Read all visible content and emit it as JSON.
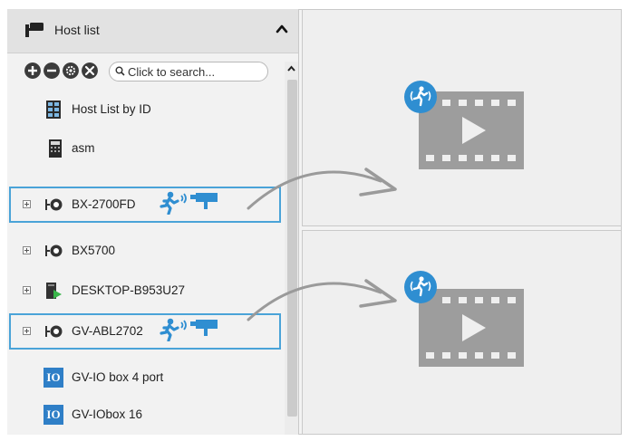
{
  "host_panel": {
    "title": "Host list",
    "header_icon": "camera-mount-icon",
    "collapse_icon": "chevron-up-icon"
  },
  "toolbar": {
    "buttons": [
      "add-icon",
      "remove-icon",
      "settings-icon",
      "tools-icon"
    ],
    "search_placeholder": "Click to search..."
  },
  "tree": {
    "items": [
      {
        "label": "Host List by ID",
        "icon": "host-list-icon"
      },
      {
        "label": "asm",
        "icon": "calculator-icon"
      },
      {
        "label": "BX-2700FD",
        "icon": "camera-icon",
        "expandable": true,
        "highlighted": true
      },
      {
        "label": "BX5700",
        "icon": "camera-icon",
        "expandable": true
      },
      {
        "label": "DESKTOP-B953U27",
        "icon": "computer-icon",
        "expandable": true
      },
      {
        "label": "GV-ABL2702",
        "icon": "camera-icon",
        "expandable": true,
        "highlighted": true
      },
      {
        "label": "GV-IO box 4 port",
        "icon": "io-box-icon"
      },
      {
        "label": "GV-IObox 16",
        "icon": "io-box-icon"
      }
    ],
    "io_icon_text": "IO"
  },
  "colors": {
    "accent": "#2f8ed1",
    "highlight_border": "#4aa3d8",
    "video_icon": "#9d9d9d",
    "arrow": "#9a9a9a"
  }
}
